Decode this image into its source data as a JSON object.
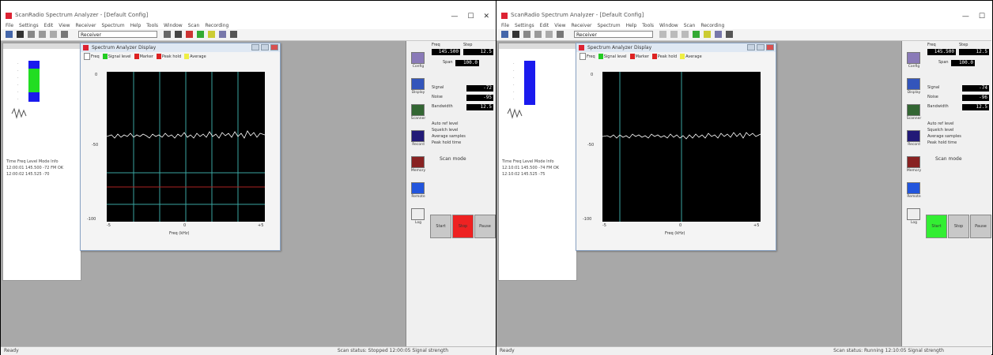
{
  "left": {
    "app_title": "ScanRadio Spectrum Analyzer - [Default Config]",
    "window_controls": [
      "—",
      "☐",
      "✕"
    ],
    "menu": [
      "File",
      "Settings",
      "Edit",
      "View",
      "Receiver",
      "Spectrum",
      "Help",
      "Tools",
      "Window",
      "Scan",
      "Recording"
    ],
    "toolbar_combo": "Receiver",
    "log_lines": [
      "Time  Freq  Level  Mode  Info",
      "12:00:01  145.500  -72  FM  OK",
      "12:00:02  145.525  -70"
    ],
    "spectrum": {
      "title": "Spectrum Analyzer Display",
      "legend": [
        {
          "label": "Freq",
          "color": "#ffffff"
        },
        {
          "label": "Signal level",
          "color": "#22cc22"
        },
        {
          "label": "Marker",
          "color": "#dd2222"
        },
        {
          "label": "Peak hold",
          "color": "#dd2222"
        },
        {
          "label": "Average",
          "color": "#eeee44"
        }
      ],
      "y_ticks": [
        "0",
        "-50",
        "-100"
      ],
      "x_ticks": [
        "-5",
        "0",
        "+5"
      ],
      "x_label": "Freq (kHz)"
    },
    "side": {
      "buttons": [
        "Config",
        "Display",
        "Scanner",
        "Record",
        "Memory",
        "Remote",
        "Log"
      ],
      "readouts": [
        {
          "label": "Freq",
          "value": "145.500"
        },
        {
          "label": "Step",
          "value": "12.5"
        },
        {
          "label": "Span",
          "value": "100.0"
        },
        {
          "label": "Signal",
          "value": "-72"
        },
        {
          "label": "Noise",
          "value": "-95"
        },
        {
          "label": "Bandwidth",
          "value": "12.5"
        }
      ],
      "settings": [
        "Auto ref level",
        "Squelch level",
        "Average samples",
        "Peak hold time"
      ],
      "mode_label": "Scan mode",
      "action_buttons": [
        {
          "label": "Start",
          "color": "#c8c8c8"
        },
        {
          "label": "Stop",
          "color": "#ee2222"
        },
        {
          "label": "Pause",
          "color": "#c8c8c8"
        }
      ]
    },
    "status_left": "Ready",
    "status_right": "Scan status: Stopped  12:00:05  Signal strength"
  },
  "right": {
    "app_title": "ScanRadio Spectrum Analyzer - [Default Config]",
    "window_controls": [
      "—",
      "☐"
    ],
    "menu": [
      "File",
      "Settings",
      "Edit",
      "View",
      "Receiver",
      "Spectrum",
      "Help",
      "Tools",
      "Window",
      "Scan",
      "Recording"
    ],
    "toolbar_combo": "Receiver",
    "log_lines": [
      "Time  Freq  Level  Mode  Info",
      "12:10:01  145.500  -74  FM  OK",
      "12:10:02  145.525  -75"
    ],
    "spectrum": {
      "title": "Spectrum Analyzer Display",
      "legend": [
        {
          "label": "Freq",
          "color": "#ffffff"
        },
        {
          "label": "Signal level",
          "color": "#22cc22"
        },
        {
          "label": "Marker",
          "color": "#dd2222"
        },
        {
          "label": "Peak hold",
          "color": "#dd2222"
        },
        {
          "label": "Average",
          "color": "#eeee44"
        }
      ],
      "y_ticks": [
        "0",
        "-50",
        "-100"
      ],
      "x_ticks": [
        "-5",
        "0",
        "+5"
      ],
      "x_label": "Freq (kHz)"
    },
    "side": {
      "buttons": [
        "Config",
        "Display",
        "Scanner",
        "Record",
        "Memory",
        "Remote",
        "Log"
      ],
      "readouts": [
        {
          "label": "Freq",
          "value": "145.500"
        },
        {
          "label": "Step",
          "value": "12.5"
        },
        {
          "label": "Span",
          "value": "100.0"
        },
        {
          "label": "Signal",
          "value": "-74"
        },
        {
          "label": "Noise",
          "value": "-96"
        },
        {
          "label": "Bandwidth",
          "value": "12.5"
        }
      ],
      "settings": [
        "Auto ref level",
        "Squelch level",
        "Average samples",
        "Peak hold time"
      ],
      "mode_label": "Scan mode",
      "action_buttons": [
        {
          "label": "Start",
          "color": "#33ee33"
        },
        {
          "label": "Stop",
          "color": "#c8c8c8"
        },
        {
          "label": "Pause",
          "color": "#c8c8c8"
        }
      ]
    },
    "status_left": "Ready",
    "status_right": "Scan status: Running  12:10:05  Signal strength"
  }
}
